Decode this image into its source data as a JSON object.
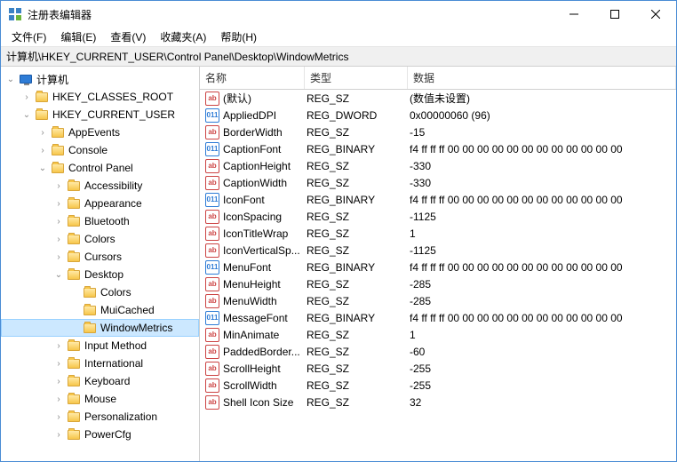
{
  "window": {
    "title": "注册表编辑器"
  },
  "menu": {
    "file": "文件(F)",
    "edit": "编辑(E)",
    "view": "查看(V)",
    "fav": "收藏夹(A)",
    "help": "帮助(H)"
  },
  "address": "计算机\\HKEY_CURRENT_USER\\Control Panel\\Desktop\\WindowMetrics",
  "tree": {
    "root": "计算机",
    "hkcr": "HKEY_CLASSES_ROOT",
    "hkcu": "HKEY_CURRENT_USER",
    "appevents": "AppEvents",
    "console": "Console",
    "controlpanel": "Control Panel",
    "accessibility": "Accessibility",
    "appearance": "Appearance",
    "bluetooth": "Bluetooth",
    "colors": "Colors",
    "cursors": "Cursors",
    "desktop": "Desktop",
    "colors2": "Colors",
    "muicached": "MuiCached",
    "windowmetrics": "WindowMetrics",
    "inputmethod": "Input Method",
    "international": "International",
    "keyboard": "Keyboard",
    "mouse": "Mouse",
    "personalization": "Personalization",
    "powercfg": "PowerCfg"
  },
  "cols": {
    "name": "名称",
    "type": "类型",
    "data": "数据"
  },
  "values": [
    {
      "icon": "sz",
      "name": "(默认)",
      "type": "REG_SZ",
      "data": "(数值未设置)"
    },
    {
      "icon": "bin",
      "name": "AppliedDPI",
      "type": "REG_DWORD",
      "data": "0x00000060 (96)"
    },
    {
      "icon": "sz",
      "name": "BorderWidth",
      "type": "REG_SZ",
      "data": "-15"
    },
    {
      "icon": "bin",
      "name": "CaptionFont",
      "type": "REG_BINARY",
      "data": "f4 ff ff ff 00 00 00 00 00 00 00 00 00 00 00 00"
    },
    {
      "icon": "sz",
      "name": "CaptionHeight",
      "type": "REG_SZ",
      "data": "-330"
    },
    {
      "icon": "sz",
      "name": "CaptionWidth",
      "type": "REG_SZ",
      "data": "-330"
    },
    {
      "icon": "bin",
      "name": "IconFont",
      "type": "REG_BINARY",
      "data": "f4 ff ff ff 00 00 00 00 00 00 00 00 00 00 00 00"
    },
    {
      "icon": "sz",
      "name": "IconSpacing",
      "type": "REG_SZ",
      "data": "-1125"
    },
    {
      "icon": "sz",
      "name": "IconTitleWrap",
      "type": "REG_SZ",
      "data": "1"
    },
    {
      "icon": "sz",
      "name": "IconVerticalSp...",
      "type": "REG_SZ",
      "data": "-1125"
    },
    {
      "icon": "bin",
      "name": "MenuFont",
      "type": "REG_BINARY",
      "data": "f4 ff ff ff 00 00 00 00 00 00 00 00 00 00 00 00"
    },
    {
      "icon": "sz",
      "name": "MenuHeight",
      "type": "REG_SZ",
      "data": "-285"
    },
    {
      "icon": "sz",
      "name": "MenuWidth",
      "type": "REG_SZ",
      "data": "-285"
    },
    {
      "icon": "bin",
      "name": "MessageFont",
      "type": "REG_BINARY",
      "data": "f4 ff ff ff 00 00 00 00 00 00 00 00 00 00 00 00"
    },
    {
      "icon": "sz",
      "name": "MinAnimate",
      "type": "REG_SZ",
      "data": "1"
    },
    {
      "icon": "sz",
      "name": "PaddedBorder...",
      "type": "REG_SZ",
      "data": "-60"
    },
    {
      "icon": "sz",
      "name": "ScrollHeight",
      "type": "REG_SZ",
      "data": "-255"
    },
    {
      "icon": "sz",
      "name": "ScrollWidth",
      "type": "REG_SZ",
      "data": "-255"
    },
    {
      "icon": "sz",
      "name": "Shell Icon Size",
      "type": "REG_SZ",
      "data": "32"
    }
  ]
}
